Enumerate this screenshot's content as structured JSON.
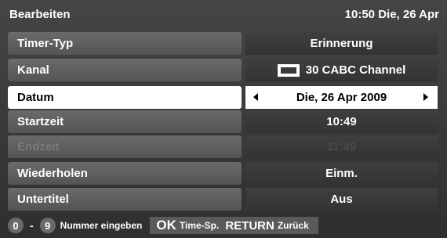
{
  "header": {
    "title": "Bearbeiten",
    "datetime": "10:50 Die, 26 Apr"
  },
  "rows": [
    {
      "label": "Timer-Typ",
      "value": "Erinnerung"
    },
    {
      "label": "Kanal",
      "value": "30 CABC Channel",
      "icon": "tv-channel-icon"
    },
    {
      "label": "Datum",
      "value": "Die, 26 Apr 2009",
      "selected": true
    },
    {
      "label": "Startzeit",
      "value": "10:49"
    },
    {
      "label": "Endzeit",
      "value": "11:49",
      "disabled": true
    },
    {
      "label": "Wiederholen",
      "value": "Einm."
    },
    {
      "label": "Untertitel",
      "value": "Aus"
    }
  ],
  "footer": {
    "key_from": "0",
    "separator": "-",
    "key_to": "9",
    "number_help": "Nummer eingeben",
    "ok_key": "OK",
    "ok_help": "Time-Sp.",
    "return_key": "RETURN",
    "return_help": "Zurück"
  },
  "colors": {
    "background": "#3a3a3a",
    "label_bg": "#5e5e5e",
    "value_bg": "#383838",
    "selected_bg": "#ffffff",
    "selected_text": "#000000"
  }
}
